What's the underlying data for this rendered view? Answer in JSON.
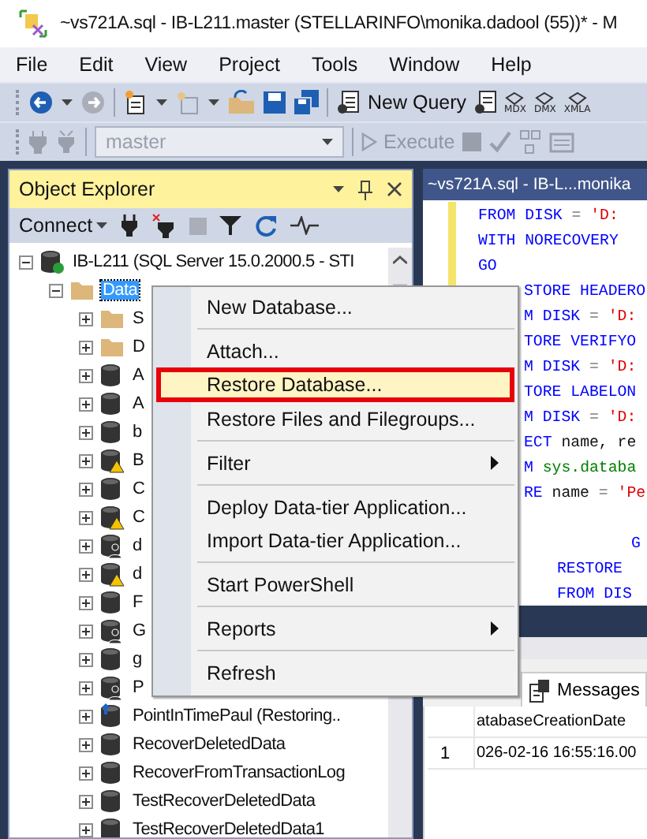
{
  "window": {
    "title": "~vs721A.sql - IB-L211.master (STELLARINFO\\monika.dadool (55))* - M"
  },
  "menu_bar": [
    "File",
    "Edit",
    "View",
    "Project",
    "Tools",
    "Window",
    "Help"
  ],
  "toolbar": {
    "new_query": "New Query",
    "query_types": [
      "MDX",
      "DMX",
      "XMLA"
    ]
  },
  "query_toolbar": {
    "database": "master",
    "database_disabled": true,
    "execute": "Execute",
    "execute_disabled": true
  },
  "object_explorer": {
    "title": "Object Explorer",
    "connect": "Connect",
    "tree": [
      {
        "label": "IB-L211 (SQL Server 15.0.2000.5 - STI",
        "kind": "server",
        "expanded": true,
        "selected": false,
        "children": [
          {
            "label": "Data",
            "kind": "folder",
            "expanded": true,
            "selected": true,
            "children": [
              {
                "label": "S",
                "kind": "folder",
                "expanded": false,
                "selected": false
              },
              {
                "label": "D",
                "kind": "folder",
                "expanded": false,
                "selected": false
              },
              {
                "label": "A",
                "kind": "database",
                "expanded": false,
                "selected": false
              },
              {
                "label": "A",
                "kind": "database",
                "expanded": false,
                "selected": false
              },
              {
                "label": "b",
                "kind": "database",
                "expanded": false,
                "selected": false
              },
              {
                "label": "B",
                "kind": "warning",
                "expanded": false,
                "selected": false
              },
              {
                "label": "C",
                "kind": "database",
                "expanded": false,
                "selected": false
              },
              {
                "label": "C",
                "kind": "warning",
                "expanded": false,
                "selected": false
              },
              {
                "label": "d",
                "kind": "single-user",
                "expanded": false,
                "selected": false
              },
              {
                "label": "d",
                "kind": "warning",
                "expanded": false,
                "selected": false
              },
              {
                "label": "F",
                "kind": "database",
                "expanded": false,
                "selected": false
              },
              {
                "label": "G",
                "kind": "single-user",
                "expanded": false,
                "selected": false
              },
              {
                "label": "g",
                "kind": "database",
                "expanded": false,
                "selected": false
              },
              {
                "label": "P",
                "kind": "single-user",
                "expanded": false,
                "selected": false
              },
              {
                "label": "PointInTimePaul (Restoring..",
                "kind": "restoring",
                "expanded": false,
                "selected": false
              },
              {
                "label": "RecoverDeletedData",
                "kind": "database",
                "expanded": false,
                "selected": false
              },
              {
                "label": "RecoverFromTransactionLog",
                "kind": "database",
                "expanded": false,
                "selected": false
              },
              {
                "label": "TestRecoverDeletedData",
                "kind": "database",
                "expanded": false,
                "selected": false
              },
              {
                "label": "TestRecoverDeletedData1",
                "kind": "database",
                "expanded": false,
                "selected": false
              }
            ]
          }
        ]
      }
    ]
  },
  "context_menu": [
    {
      "label": "New Database...",
      "separator_before": false,
      "submenu": false,
      "selected": false
    },
    {
      "label": "Attach...",
      "separator_before": true,
      "submenu": false,
      "selected": false
    },
    {
      "label": "Restore Database...",
      "separator_before": false,
      "submenu": false,
      "selected": true
    },
    {
      "label": "Restore Files and Filegroups...",
      "separator_before": false,
      "submenu": false,
      "selected": false
    },
    {
      "label": "Filter",
      "separator_before": true,
      "submenu": true,
      "selected": false
    },
    {
      "label": "Deploy Data-tier Application...",
      "separator_before": true,
      "submenu": false,
      "selected": false
    },
    {
      "label": "Import Data-tier Application...",
      "separator_before": false,
      "submenu": false,
      "selected": false
    },
    {
      "label": "Start PowerShell",
      "separator_before": true,
      "submenu": false,
      "selected": false
    },
    {
      "label": "Reports",
      "separator_before": true,
      "submenu": true,
      "selected": false
    },
    {
      "label": "Refresh",
      "separator_before": true,
      "submenu": false,
      "selected": false
    }
  ],
  "editor": {
    "tab": "~vs721A.sql - IB-L...monika",
    "lines": [
      {
        "kind": "plain",
        "tokens": [
          {
            "kind": "keyword",
            "text": "FROM DISK "
          },
          {
            "kind": "operator",
            "text": "= "
          },
          {
            "kind": "string",
            "text": "'D:"
          }
        ]
      },
      {
        "kind": "plain",
        "tokens": [
          {
            "kind": "keyword",
            "text": "WITH NORECOVERY"
          }
        ]
      },
      {
        "kind": "plain",
        "tokens": [
          {
            "kind": "keyword",
            "text": "GO"
          }
        ]
      },
      {
        "kind": "hidden-start",
        "tokens": [
          {
            "kind": "keyword",
            "text": "STORE HEADERO"
          }
        ]
      },
      {
        "kind": "hidden-start",
        "tokens": [
          {
            "kind": "keyword",
            "text": "M DISK "
          },
          {
            "kind": "operator",
            "text": "= "
          },
          {
            "kind": "string",
            "text": "'D:"
          }
        ]
      },
      {
        "kind": "hidden-start",
        "tokens": [
          {
            "kind": "keyword",
            "text": "TORE VERIFYO"
          }
        ]
      },
      {
        "kind": "hidden-start",
        "tokens": [
          {
            "kind": "keyword",
            "text": "M DISK "
          },
          {
            "kind": "operator",
            "text": "= "
          },
          {
            "kind": "string",
            "text": "'D:"
          }
        ]
      },
      {
        "kind": "hidden-start",
        "tokens": [
          {
            "kind": "keyword",
            "text": "TORE LABELON"
          }
        ]
      },
      {
        "kind": "hidden-start",
        "tokens": [
          {
            "kind": "keyword",
            "text": "M DISK "
          },
          {
            "kind": "operator",
            "text": "= "
          },
          {
            "kind": "string",
            "text": "'D:"
          }
        ]
      },
      {
        "kind": "hidden-start",
        "tokens": [
          {
            "kind": "keyword",
            "text": "ECT "
          },
          {
            "kind": "plain",
            "text": "name, re"
          }
        ]
      },
      {
        "kind": "hidden-start",
        "tokens": [
          {
            "kind": "keyword",
            "text": "M "
          },
          {
            "kind": "object",
            "text": "sys.databa"
          }
        ]
      },
      {
        "kind": "hidden-start",
        "tokens": [
          {
            "kind": "keyword",
            "text": "RE "
          },
          {
            "kind": "plain",
            "text": "name "
          },
          {
            "kind": "operator",
            "text": "= "
          },
          {
            "kind": "string",
            "text": "'Pe"
          }
        ]
      },
      {
        "kind": "blank"
      },
      {
        "kind": "deep",
        "tokens": [
          {
            "kind": "keyword",
            "text": "G"
          }
        ]
      },
      {
        "kind": "nested",
        "tokens": [
          {
            "kind": "keyword",
            "text": "RESTORE"
          }
        ]
      },
      {
        "kind": "nested",
        "tokens": [
          {
            "kind": "keyword",
            "text": "FROM DIS"
          }
        ]
      }
    ]
  },
  "results": {
    "tab": "Messages",
    "columns": [
      "atabaseCreationDate"
    ],
    "rows": [
      {
        "number": "1",
        "cells": [
          "026-02-16 16:55:16.00"
        ]
      }
    ]
  }
}
